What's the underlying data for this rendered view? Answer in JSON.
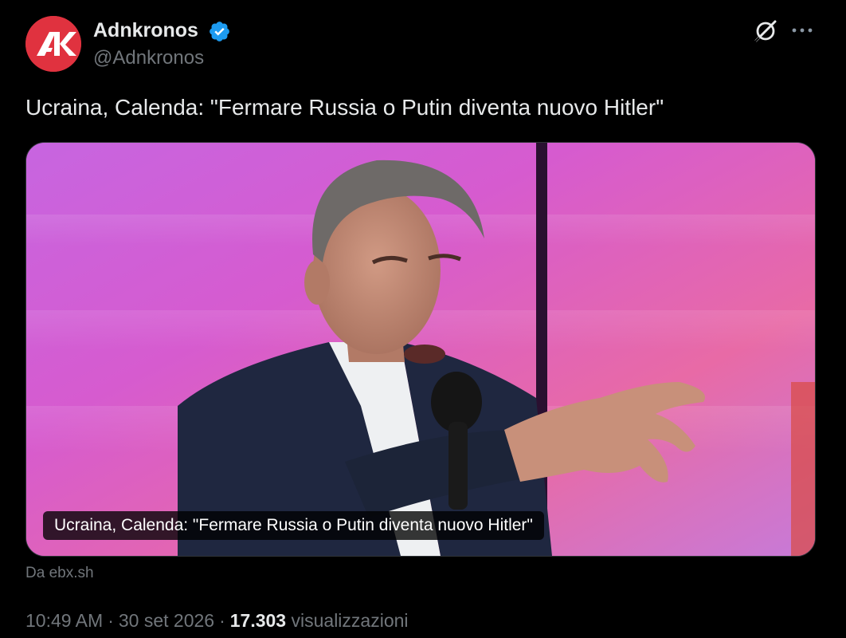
{
  "account": {
    "display_name": "Adnkronos",
    "handle": "@Adnkronos",
    "verified": true,
    "avatar_letters": "AK",
    "avatar_color": "#e0323f",
    "verified_color": "#1d9bf0"
  },
  "icons": {
    "grok": "grok-icon",
    "more": "more-icon"
  },
  "tweet": {
    "text": "Ucraina, Calenda: \"Fermare Russia o Putin diventa nuovo Hitler\""
  },
  "card": {
    "caption": "Ucraina, Calenda: \"Fermare Russia o Putin diventa nuovo Hitler\"",
    "source": "Da ebx.sh",
    "image_subject": "man speaking into a microphone"
  },
  "meta": {
    "time": "10:49 AM",
    "separator": "·",
    "date": "30 set 2026",
    "views_count": "17.303",
    "views_label": "visualizzazioni"
  },
  "colors": {
    "background": "#000000",
    "text_primary": "#e7e9ea",
    "text_secondary": "#71767b"
  }
}
